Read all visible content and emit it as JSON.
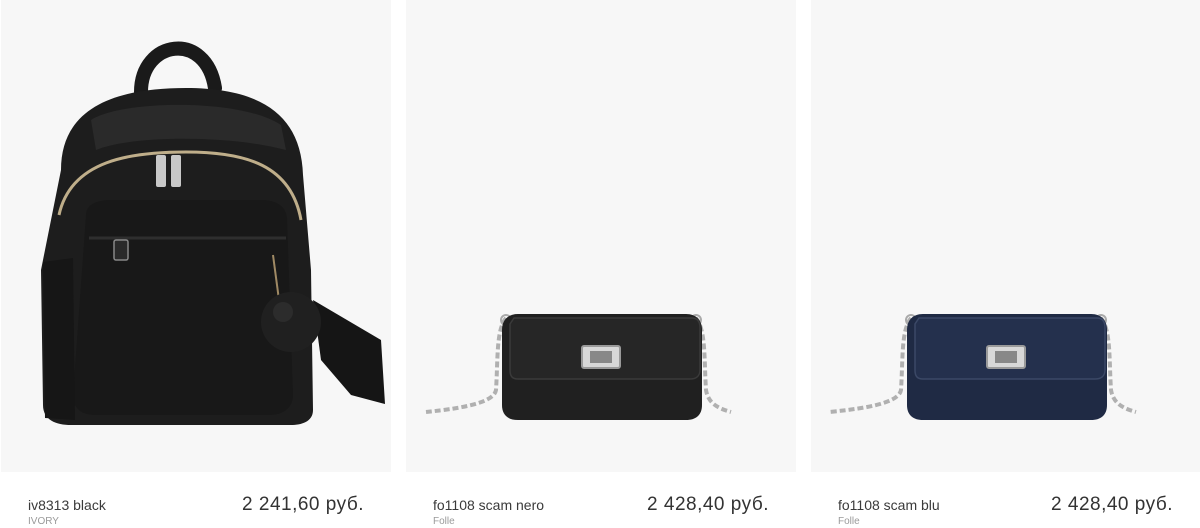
{
  "products": [
    {
      "name": "iv8313 black",
      "brand": "IVORY",
      "price": "2 241,60 руб.",
      "image_icon": "backpack-icon",
      "color": "#1c1c1c"
    },
    {
      "name": "fo1108 scam nero",
      "brand": "Folle",
      "price": "2 428,40 руб.",
      "image_icon": "handbag-icon",
      "color": "#222222"
    },
    {
      "name": "fo1108 scam blu",
      "brand": "Folle",
      "price": "2 428,40 руб.",
      "image_icon": "handbag-icon",
      "color": "#1f2a44"
    }
  ]
}
